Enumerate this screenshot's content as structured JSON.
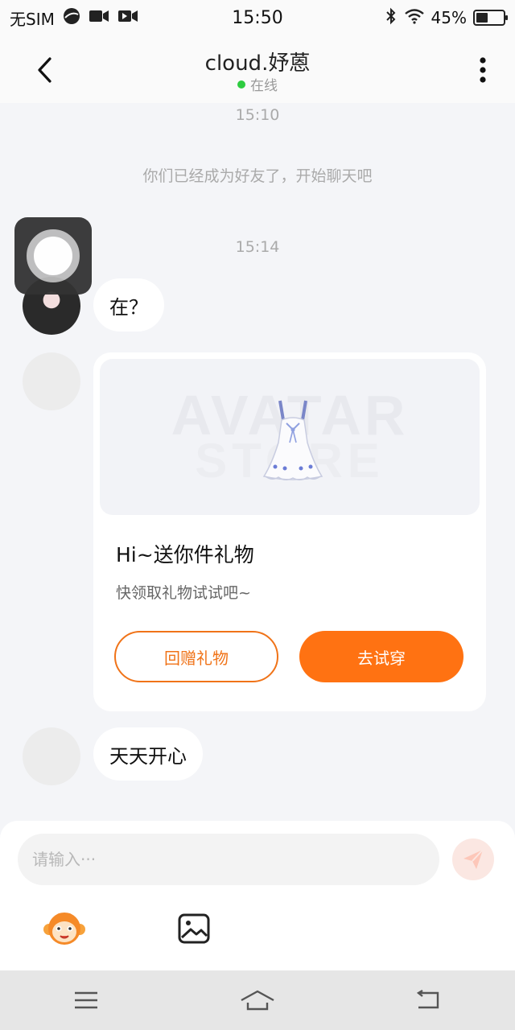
{
  "status_bar": {
    "carrier": "无SIM",
    "time": "15:50",
    "battery_percent": "45%",
    "battery_level": 0.45,
    "icons": [
      "browser-icon",
      "video-icon",
      "video-play-icon",
      "bluetooth-icon",
      "wifi-icon",
      "battery-icon"
    ]
  },
  "header": {
    "title": "cloud.妤蒽",
    "status": "在线",
    "status_color": "#2ecc40"
  },
  "chat": {
    "time_1": "15:10",
    "system_message": "你们已经成为好友了，开始聊天吧",
    "time_2": "15:14",
    "messages": [
      {
        "text": "在？"
      },
      {
        "text": "天天开心"
      }
    ],
    "gift_card": {
      "watermark_1": "AVATAR",
      "watermark_2": "STORE",
      "title": "Hi~送你件礼物",
      "description": "快领取礼物试试吧~",
      "return_gift_label": "回赠礼物",
      "try_on_label": "去试穿",
      "accent": "#ff7212"
    }
  },
  "input": {
    "placeholder": "请输入···"
  }
}
